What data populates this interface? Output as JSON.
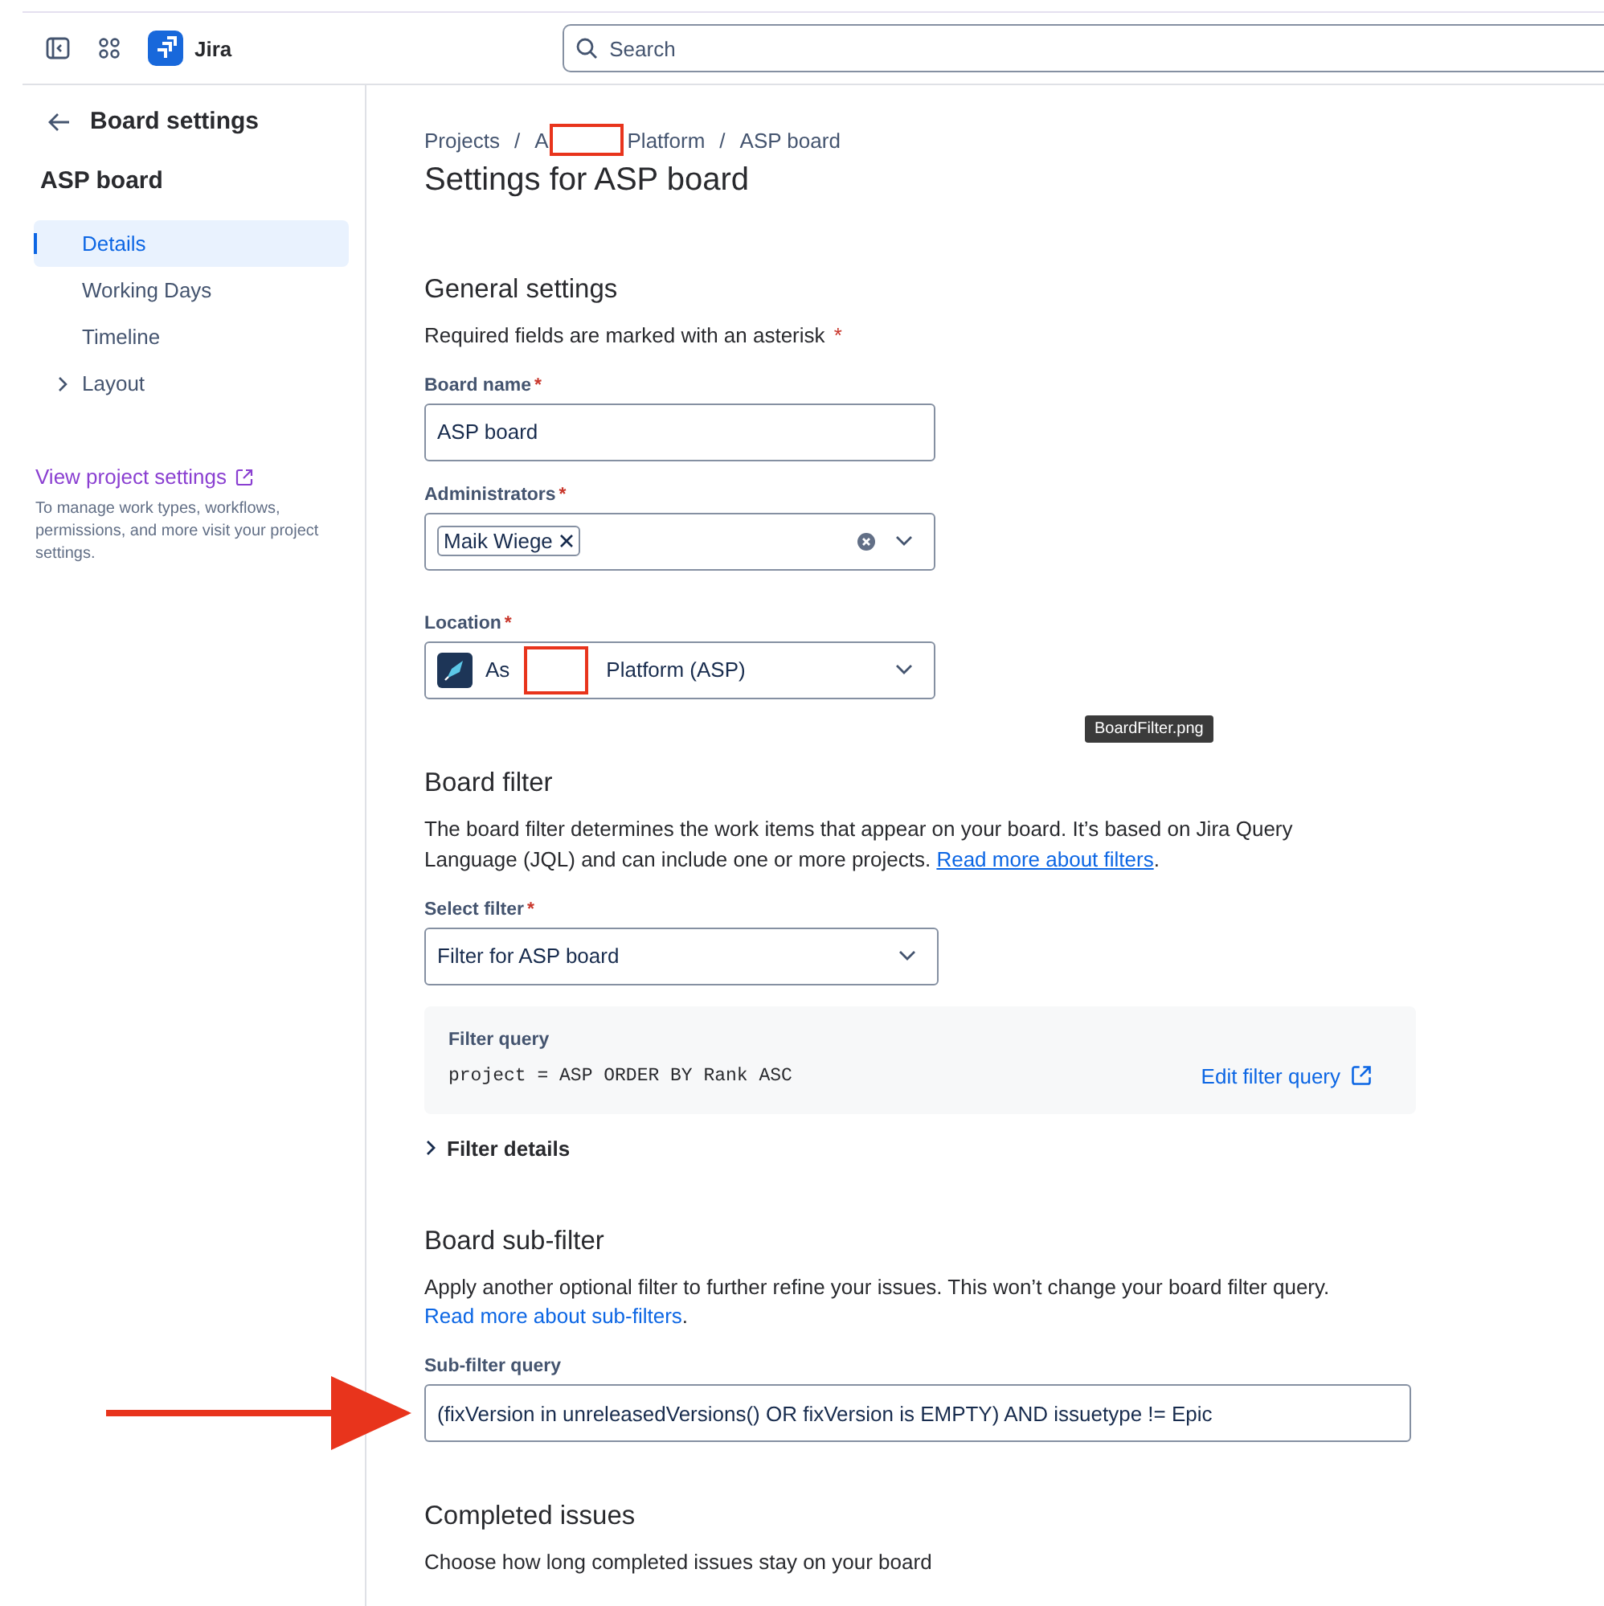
{
  "topbar": {
    "product": "Jira",
    "search": {
      "placeholder": "Search"
    }
  },
  "sidebar": {
    "back_label": "Board settings",
    "board": "ASP board",
    "items": [
      {
        "label": "Details",
        "kind": "link",
        "selected": true
      },
      {
        "label": "Working Days",
        "kind": "link",
        "selected": false
      },
      {
        "label": "Timeline",
        "kind": "link",
        "selected": false
      },
      {
        "label": "Layout",
        "kind": "group",
        "selected": false,
        "expanded": false
      }
    ],
    "project_link": "View project settings",
    "project_note": "To manage work types, workflows, permissions, and more visit your project settings."
  },
  "breadcrumb": {
    "separator": "/",
    "crumbs": [
      {
        "parts": [
          "Projects"
        ]
      },
      {
        "parts": [
          "A",
          "Platform"
        ]
      },
      {
        "parts": [
          "ASP board"
        ]
      }
    ]
  },
  "title": "Settings for ASP board",
  "general": {
    "heading": "General settings",
    "note": "Required fields are marked with an asterisk",
    "note_mark": "*",
    "board_name": {
      "label": "Board name",
      "mark": "*",
      "value": "ASP board"
    },
    "administrators": {
      "label": "Administrators",
      "mark": "*",
      "chips": [
        "Maik Wiege"
      ]
    },
    "location": {
      "label": "Location",
      "mark": "*",
      "parts": [
        "As",
        "Platform (ASP)"
      ]
    }
  },
  "tooltip": "BoardFilter.png",
  "board_filter": {
    "heading": "Board filter",
    "description": "The board filter determines the work items that appear on your board. It’s based on Jira Query Language (JQL) and can include one or more projects. ",
    "link": "Read more about filters",
    "after": ".",
    "select": {
      "label": "Select filter",
      "mark": "*",
      "value": "Filter for ASP board"
    },
    "query": {
      "label": "Filter query",
      "value": "project = ASP ORDER BY Rank ASC",
      "edit_link": "Edit filter query"
    },
    "details": {
      "label": "Filter details",
      "expanded": false
    }
  },
  "sub_filter": {
    "heading": "Board sub-filter",
    "description": "Apply another optional filter to further refine your issues. This won’t change your board filter query.",
    "link": "Read more about sub-filters",
    "after": ".",
    "label": "Sub-filter query",
    "value": "(fixVersion in unreleasedVersions() OR fixVersion is EMPTY) AND issuetype != Epic"
  },
  "completed": {
    "heading": "Completed issues",
    "description": "Choose how long completed issues stay on your board"
  }
}
